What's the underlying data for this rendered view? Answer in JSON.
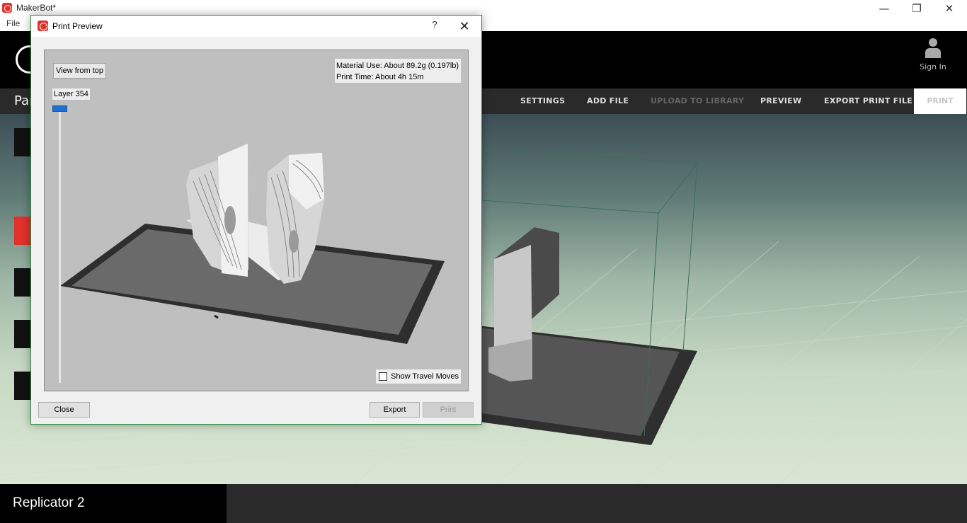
{
  "window": {
    "title": "MakerBot*",
    "menu": [
      "File"
    ]
  },
  "header": {
    "sign_in": "Sign In"
  },
  "nav": {
    "left_label": "Par",
    "items": [
      {
        "label": "SETTINGS",
        "enabled": true
      },
      {
        "label": "ADD FILE",
        "enabled": true
      },
      {
        "label": "UPLOAD TO LIBRARY",
        "enabled": false
      },
      {
        "label": "PREVIEW",
        "enabled": true
      },
      {
        "label": "EXPORT PRINT FILE",
        "enabled": true
      }
    ],
    "print": "PRINT"
  },
  "status": {
    "printer": "Replicator 2"
  },
  "dialog": {
    "title": "Print Preview",
    "help": "?",
    "view_from_top": "View from top",
    "layer": "Layer 354",
    "material_use": "Material Use: About 89.2g (0.197lb)",
    "print_time": "Print Time: About 4h 15m",
    "show_travel_moves": "Show Travel Moves",
    "show_travel_checked": false,
    "buttons": {
      "close": "Close",
      "export": "Export",
      "print": "Print"
    }
  },
  "colors": {
    "accent": "#e0312b",
    "slider": "#1f6fd6"
  }
}
